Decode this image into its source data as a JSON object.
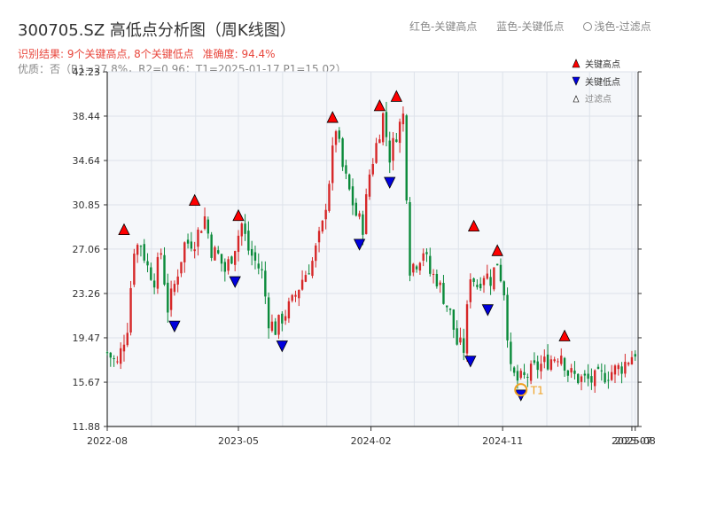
{
  "header": {
    "title": "300705.SZ 高低点分析图（周K线图）",
    "legend_red": "红色-关键高点",
    "legend_blue": "蓝色-关键低点",
    "legend_light": "浅色-过滤点",
    "result_text": "识别结果: 9个关键高点, 8个关键低点",
    "accuracy_text": "准确度: 94.4%",
    "quality_text": "优质：否（R1=27.8%，R2=0.96；T1=2025-01-17 P1=15.02）"
  },
  "colors": {
    "up": "#d62728",
    "down": "#0a8a3a",
    "high_marker": "#ff0000",
    "low_marker": "#0000dd",
    "filtered": "#f0a020",
    "plot_bg": "#f5f7fa",
    "grid": "#dde2ea"
  },
  "chart_data": {
    "type": "candlestick",
    "title": "300705.SZ 高低点分析图（周K线图）",
    "x_type": "date",
    "xlim": [
      "2022-08-01",
      "2025-08-10"
    ],
    "ylim": [
      11.88,
      42.23
    ],
    "y_ticks": [
      "11.88",
      "15.67",
      "19.47",
      "23.26",
      "27.06",
      "30.85",
      "34.64",
      "38.44",
      "42.23"
    ],
    "x_ticks": [
      {
        "date": "2022-08-01",
        "label": "2022-08"
      },
      {
        "date": "2023-05-01",
        "label": "2023-05"
      },
      {
        "date": "2024-02-01",
        "label": "2024-02"
      },
      {
        "date": "2024-11-01",
        "label": "2024-11"
      },
      {
        "date": "2025-07-28",
        "label": "2025-07"
      },
      {
        "date": "2025-08-04",
        "label": "2025-08"
      }
    ],
    "grid": true,
    "legend": {
      "placement": "top-right",
      "entries": [
        {
          "key": "high",
          "label": "关键高点"
        },
        {
          "key": "low",
          "label": "关键低点"
        },
        {
          "key": "filtered",
          "label": "过滤点"
        }
      ]
    },
    "close_path": [
      [
        "2022-08-01",
        18.2
      ],
      [
        "2022-08-22",
        17.2
      ],
      [
        "2022-09-12",
        20.5
      ],
      [
        "2022-09-26",
        27.2
      ],
      [
        "2022-10-10",
        27.5
      ],
      [
        "2022-10-24",
        25.5
      ],
      [
        "2022-11-07",
        24.5
      ],
      [
        "2022-11-21",
        26.8
      ],
      [
        "2022-12-05",
        22.0
      ],
      [
        "2022-12-19",
        24.0
      ],
      [
        "2023-01-09",
        27.5
      ],
      [
        "2023-01-30",
        27.8
      ],
      [
        "2023-02-20",
        29.8
      ],
      [
        "2023-03-06",
        27.0
      ],
      [
        "2023-03-20",
        26.5
      ],
      [
        "2023-04-03",
        25.2
      ],
      [
        "2023-04-17",
        26.5
      ],
      [
        "2023-05-08",
        29.2
      ],
      [
        "2023-05-22",
        27.0
      ],
      [
        "2023-06-05",
        26.0
      ],
      [
        "2023-06-19",
        25.0
      ],
      [
        "2023-07-03",
        21.0
      ],
      [
        "2023-07-17",
        20.2
      ],
      [
        "2023-07-31",
        21.2
      ],
      [
        "2023-08-21",
        22.5
      ],
      [
        "2023-09-11",
        24.5
      ],
      [
        "2023-10-02",
        26.0
      ],
      [
        "2023-10-23",
        29.0
      ],
      [
        "2023-11-06",
        33.0
      ],
      [
        "2023-11-20",
        37.5
      ],
      [
        "2023-12-04",
        34.0
      ],
      [
        "2023-12-18",
        32.0
      ],
      [
        "2024-01-01",
        30.0
      ],
      [
        "2024-01-15",
        29.0
      ],
      [
        "2024-01-29",
        33.5
      ],
      [
        "2024-02-12",
        36.0
      ],
      [
        "2024-02-26",
        38.5
      ],
      [
        "2024-03-11",
        35.0
      ],
      [
        "2024-03-25",
        37.0
      ],
      [
        "2024-04-08",
        38.5
      ],
      [
        "2024-04-22",
        25.5
      ],
      [
        "2024-05-06",
        26.0
      ],
      [
        "2024-05-20",
        27.0
      ],
      [
        "2024-06-03",
        25.0
      ],
      [
        "2024-06-17",
        24.5
      ],
      [
        "2024-07-01",
        23.0
      ],
      [
        "2024-07-15",
        21.5
      ],
      [
        "2024-07-29",
        19.0
      ],
      [
        "2024-08-12",
        18.5
      ],
      [
        "2024-08-26",
        25.0
      ],
      [
        "2024-09-09",
        24.0
      ],
      [
        "2024-09-23",
        25.0
      ],
      [
        "2024-10-07",
        24.5
      ],
      [
        "2024-10-21",
        26.0
      ],
      [
        "2024-11-04",
        23.5
      ],
      [
        "2024-11-18",
        16.5
      ],
      [
        "2024-12-02",
        15.8
      ],
      [
        "2024-12-16",
        16.0
      ],
      [
        "2025-01-06",
        16.8
      ],
      [
        "2025-02-03",
        17.5
      ],
      [
        "2025-03-03",
        18.2
      ],
      [
        "2025-03-17",
        16.5
      ],
      [
        "2025-04-07",
        16.0
      ],
      [
        "2025-05-05",
        15.8
      ],
      [
        "2025-06-02",
        16.3
      ],
      [
        "2025-07-07",
        17.0
      ],
      [
        "2025-08-04",
        18.3
      ]
    ],
    "key_highs": [
      {
        "date": "2022-09-05",
        "price": 28.3
      },
      {
        "date": "2023-01-30",
        "price": 30.8
      },
      {
        "date": "2023-05-01",
        "price": 29.5
      },
      {
        "date": "2023-11-13",
        "price": 37.9
      },
      {
        "date": "2024-02-19",
        "price": 38.9
      },
      {
        "date": "2024-03-25",
        "price": 39.7
      },
      {
        "date": "2024-09-02",
        "price": 28.6
      },
      {
        "date": "2024-10-21",
        "price": 26.5
      },
      {
        "date": "2025-03-10",
        "price": 19.2
      }
    ],
    "key_lows": [
      {
        "date": "2022-12-19",
        "price": 20.9
      },
      {
        "date": "2023-04-24",
        "price": 24.7
      },
      {
        "date": "2023-07-31",
        "price": 19.2
      },
      {
        "date": "2024-01-08",
        "price": 27.9
      },
      {
        "date": "2024-03-11",
        "price": 33.2
      },
      {
        "date": "2024-08-26",
        "price": 17.9
      },
      {
        "date": "2024-10-01",
        "price": 22.3
      },
      {
        "date": "2024-12-09",
        "price": 15.0
      }
    ],
    "filtered_points": [
      {
        "date": "2024-12-09",
        "price": 15.02,
        "label": "T1"
      }
    ]
  }
}
